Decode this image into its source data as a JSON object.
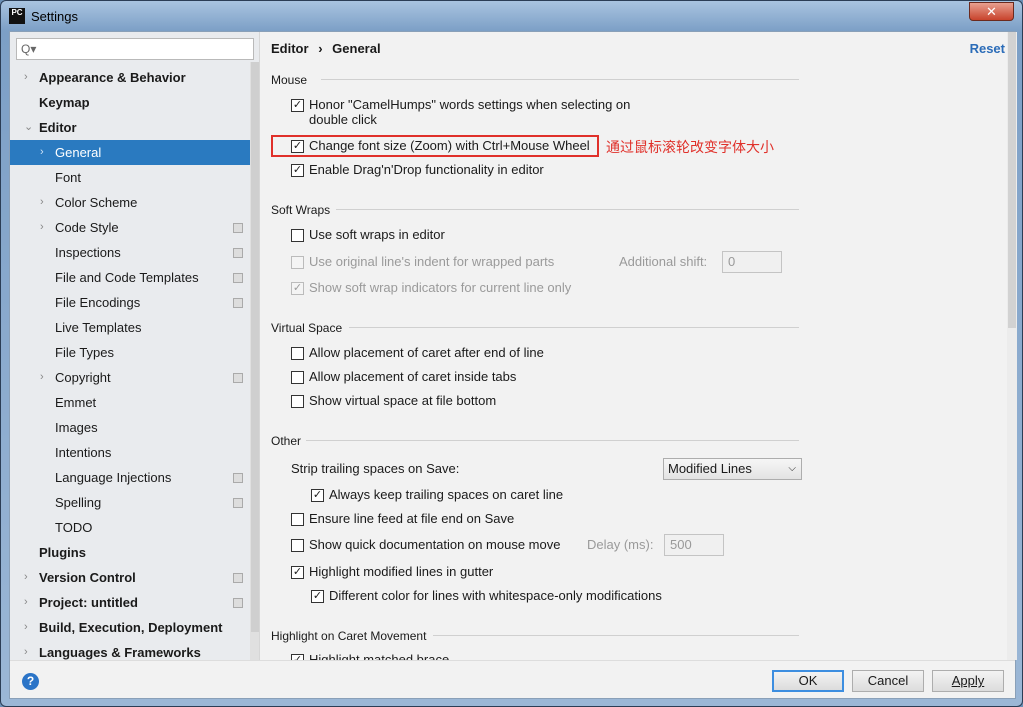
{
  "window": {
    "title": "Settings",
    "close": "✕"
  },
  "search": {
    "placeholder": "Q▾"
  },
  "tree": [
    {
      "label": "Appearance & Behavior",
      "bold": true,
      "arrow": "›",
      "level": 0
    },
    {
      "label": "Keymap",
      "bold": true,
      "arrow": "",
      "level": 0
    },
    {
      "label": "Editor",
      "bold": true,
      "arrow": "⌄",
      "level": 0
    },
    {
      "label": "General",
      "arrow": "›",
      "level": 1,
      "selected": true
    },
    {
      "label": "Font",
      "arrow": "",
      "level": 1
    },
    {
      "label": "Color Scheme",
      "arrow": "›",
      "level": 1
    },
    {
      "label": "Code Style",
      "arrow": "›",
      "level": 1,
      "copy": true
    },
    {
      "label": "Inspections",
      "arrow": "",
      "level": 1,
      "copy": true
    },
    {
      "label": "File and Code Templates",
      "arrow": "",
      "level": 1,
      "copy": true
    },
    {
      "label": "File Encodings",
      "arrow": "",
      "level": 1,
      "copy": true
    },
    {
      "label": "Live Templates",
      "arrow": "",
      "level": 1
    },
    {
      "label": "File Types",
      "arrow": "",
      "level": 1
    },
    {
      "label": "Copyright",
      "arrow": "›",
      "level": 1,
      "copy": true
    },
    {
      "label": "Emmet",
      "arrow": "",
      "level": 1
    },
    {
      "label": "Images",
      "arrow": "",
      "level": 1
    },
    {
      "label": "Intentions",
      "arrow": "",
      "level": 1
    },
    {
      "label": "Language Injections",
      "arrow": "",
      "level": 1,
      "copy": true
    },
    {
      "label": "Spelling",
      "arrow": "",
      "level": 1,
      "copy": true
    },
    {
      "label": "TODO",
      "arrow": "",
      "level": 1
    },
    {
      "label": "Plugins",
      "bold": true,
      "arrow": "",
      "level": 0
    },
    {
      "label": "Version Control",
      "bold": true,
      "arrow": "›",
      "level": 0,
      "copy": true
    },
    {
      "label": "Project: untitled",
      "bold": true,
      "arrow": "›",
      "level": 0,
      "copy": true
    },
    {
      "label": "Build, Execution, Deployment",
      "bold": true,
      "arrow": "›",
      "level": 0
    },
    {
      "label": "Languages & Frameworks",
      "bold": true,
      "arrow": "›",
      "level": 0
    }
  ],
  "breadcrumb": {
    "parent": "Editor",
    "sep": "›",
    "current": "General"
  },
  "reset": "Reset",
  "groups": {
    "mouse": "Mouse",
    "soft_wraps": "Soft Wraps",
    "virtual_space": "Virtual Space",
    "other": "Other",
    "caret": "Highlight on Caret Movement"
  },
  "options": {
    "camel": "Honor \"CamelHumps\" words settings when selecting on double click",
    "zoom": "Change font size (Zoom) with Ctrl+Mouse Wheel",
    "dnd": "Enable Drag'n'Drop functionality in editor",
    "soft": "Use soft wraps in editor",
    "indent": "Use original line's indent for wrapped parts",
    "indicators": "Show soft wrap indicators for current line only",
    "caret_end": "Allow placement of caret after end of line",
    "caret_tabs": "Allow placement of caret inside tabs",
    "virtual": "Show virtual space at file bottom",
    "keep_trailing": "Always keep trailing spaces on caret line",
    "line_feed": "Ensure line feed at file end on Save",
    "quick_doc": "Show quick documentation on mouse move",
    "highlight_mod": "Highlight modified lines in gutter",
    "diff_color": "Different color for lines with whitespace-only modifications",
    "highlight_braces": "Highlight matched brace"
  },
  "additional_shift": {
    "label": "Additional shift:",
    "value": "0"
  },
  "strip": {
    "label": "Strip trailing spaces on Save:",
    "value": "Modified Lines"
  },
  "delay": {
    "label": "Delay (ms):",
    "value": "500"
  },
  "annotation": "通过鼠标滚轮改变字体大小",
  "buttons": {
    "ok": "OK",
    "cancel": "Cancel",
    "apply": "Apply",
    "help": "?"
  },
  "colors": {
    "selection": "#2a7ac0",
    "annotation": "#e0302a",
    "link": "#2b6cb8"
  }
}
